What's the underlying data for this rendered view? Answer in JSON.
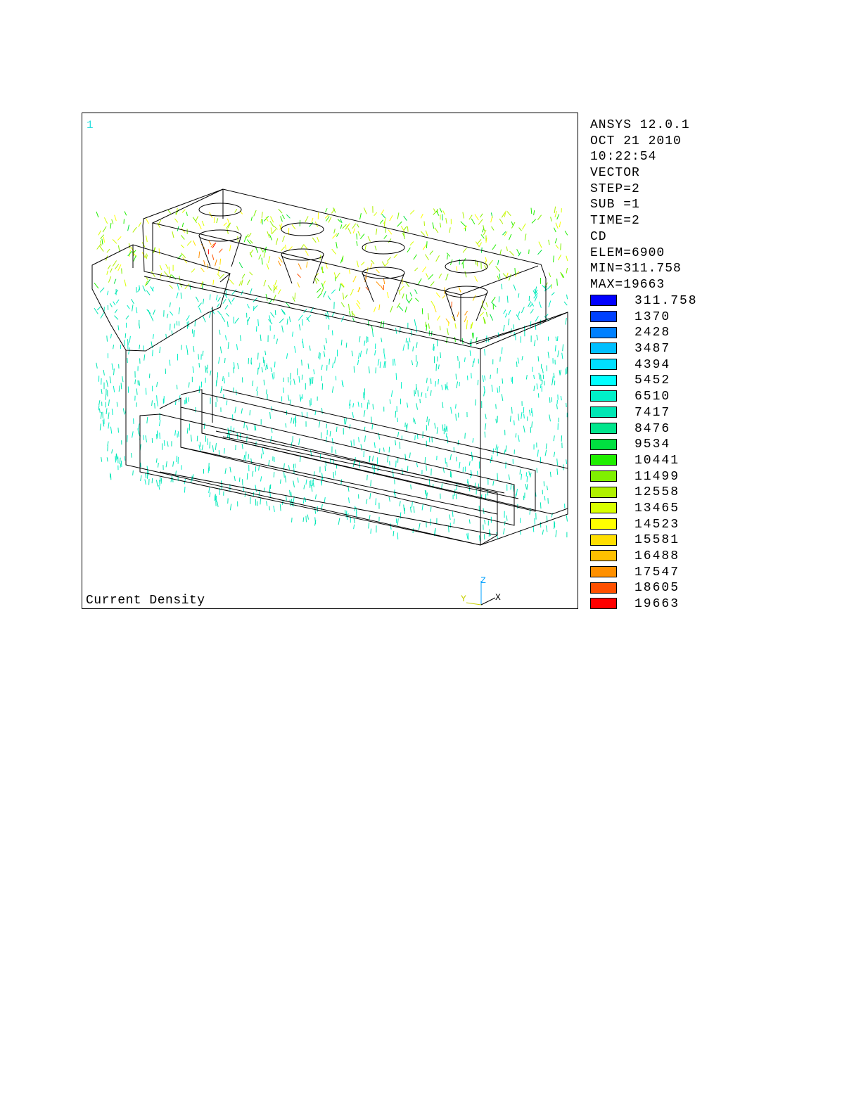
{
  "plot": {
    "window_number": "1",
    "caption": "Current Density",
    "triad": {
      "z_label": "Z",
      "y_label": "Y",
      "x_label": "X"
    }
  },
  "info": {
    "lines": [
      "ANSYS 12.0.1",
      "OCT 21 2010",
      "10:22:54",
      "VECTOR",
      "STEP=2",
      "SUB =1",
      "TIME=2",
      "CD",
      "ELEM=6900",
      "MIN=311.758",
      "MAX=19663"
    ]
  },
  "legend": {
    "levels": [
      {
        "label": "311.758",
        "color": "#0000ff"
      },
      {
        "label": "1370",
        "color": "#0040ff"
      },
      {
        "label": "2428",
        "color": "#0080ff"
      },
      {
        "label": "3487",
        "color": "#00bfff"
      },
      {
        "label": "4394",
        "color": "#00dfff"
      },
      {
        "label": "5452",
        "color": "#00ffff"
      },
      {
        "label": "6510",
        "color": "#00f0c8"
      },
      {
        "label": "7417",
        "color": "#00e6b4"
      },
      {
        "label": "8476",
        "color": "#00e68c"
      },
      {
        "label": "9534",
        "color": "#00e040"
      },
      {
        "label": "10441",
        "color": "#20ee00"
      },
      {
        "label": "11499",
        "color": "#80f000"
      },
      {
        "label": "12558",
        "color": "#b0f000"
      },
      {
        "label": "13465",
        "color": "#d8ff00"
      },
      {
        "label": "14523",
        "color": "#ffff00"
      },
      {
        "label": "15581",
        "color": "#ffde00"
      },
      {
        "label": "16488",
        "color": "#ffc000"
      },
      {
        "label": "17547",
        "color": "#ff9000"
      },
      {
        "label": "18605",
        "color": "#ff5000"
      },
      {
        "label": "19663",
        "color": "#ff0000"
      }
    ]
  }
}
